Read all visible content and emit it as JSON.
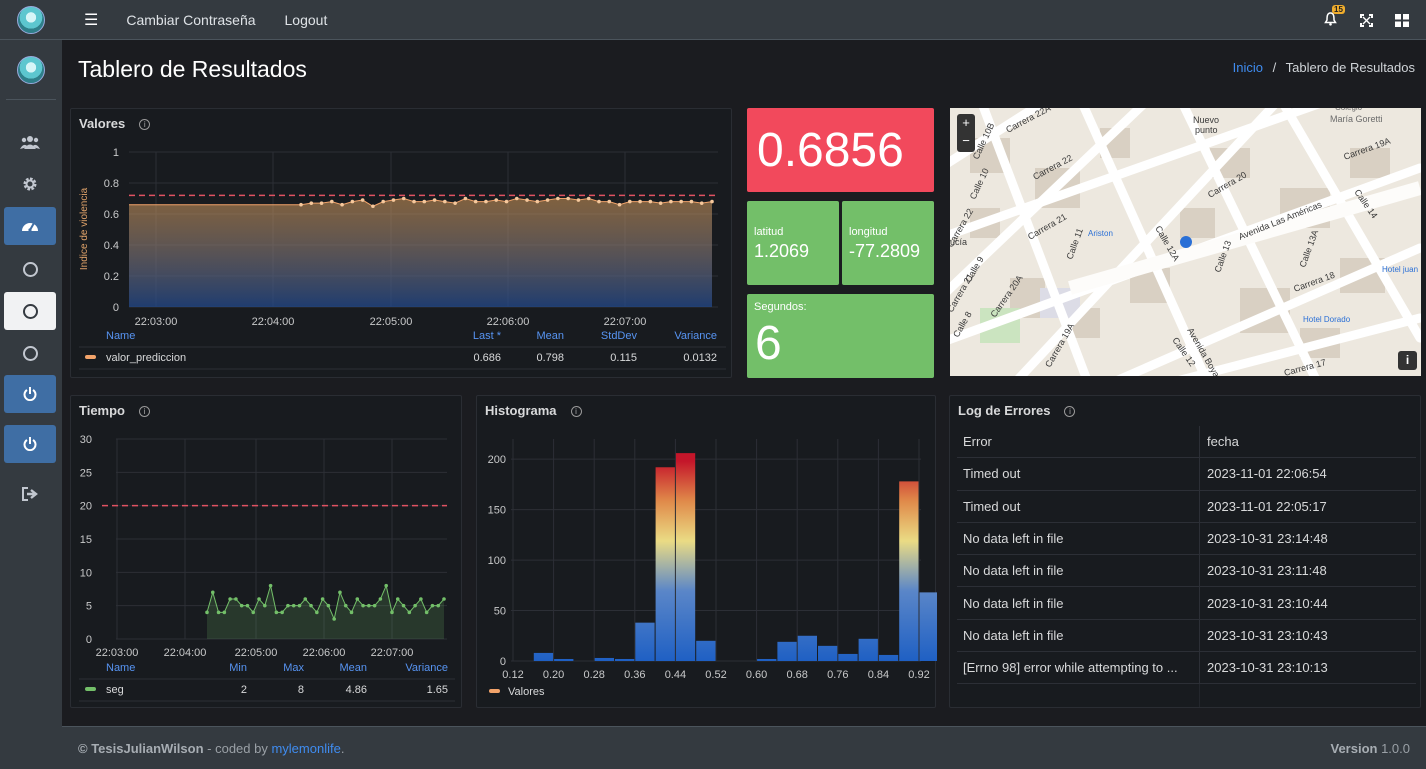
{
  "nav": {
    "change_password": "Cambiar Contraseña",
    "logout": "Logout",
    "notifications": "15"
  },
  "page": {
    "title": "Tablero de Resultados",
    "breadcrumb_home": "Inicio",
    "breadcrumb_sep": "/",
    "breadcrumb_current": "Tablero de Resultados"
  },
  "sidebar": {
    "items": [
      "users-icon",
      "gear-icon",
      "dashboard-icon",
      "circle-icon",
      "circle-icon",
      "circle-icon",
      "power-icon",
      "power-icon",
      "sign-out-icon"
    ]
  },
  "valores": {
    "title": "Valores",
    "legend_headers": {
      "name": "Name",
      "last": "Last *",
      "mean": "Mean",
      "stddev": "StdDev",
      "variance": "Variance"
    },
    "legend_row": {
      "name": "valor_prediccion",
      "last": "0.686",
      "mean": "0.798",
      "stddev": "0.115",
      "variance": "0.0132"
    }
  },
  "stat_value": {
    "value": "0.6856",
    "color": "#f2495c"
  },
  "lat": {
    "label": "latitud",
    "value": "1.2069"
  },
  "lon": {
    "label": "longitud",
    "value": "-77.2809"
  },
  "seconds": {
    "label": "Segundos:",
    "value": "6"
  },
  "map": {
    "zoom_in": "+",
    "zoom_out": "−",
    "info": "i",
    "labels": [
      "Carrera 22A",
      "Nuevo punto",
      "Colegio María Goretti",
      "Carrera 19A",
      "Calle 10B",
      "Carrera 22",
      "Carrera 20",
      "Calle 14",
      "Calle 10",
      "Carrera 22",
      "Calle 12A",
      "Avenida Las Américas",
      "Carrera 21",
      "Ariston",
      "Calle 11",
      "Calle 9",
      "Calle 13",
      "Calle 13A",
      "Hotel juan",
      "Carrera 21",
      "Carrera 20A",
      "Carrera 18",
      "Calle 8",
      "Hotel Dorado",
      "Calle 12",
      "Avenida Boya",
      "Carrera 19A",
      "Carrera 17",
      "ucía"
    ]
  },
  "tiempo": {
    "title": "Tiempo",
    "legend_headers": {
      "name": "Name",
      "min": "Min",
      "max": "Max",
      "mean": "Mean",
      "variance": "Variance"
    },
    "legend_row": {
      "name": "seg",
      "min": "2",
      "max": "8",
      "mean": "4.86",
      "variance": "1.65"
    }
  },
  "histograma": {
    "title": "Histograma",
    "legend": "Valores"
  },
  "errores": {
    "title": "Log de Errores",
    "headers": [
      "Error",
      "fecha"
    ],
    "rows": [
      [
        "Timed out",
        "2023-11-01 22:06:54"
      ],
      [
        "Timed out",
        "2023-11-01 22:05:17"
      ],
      [
        "No data left in file",
        "2023-10-31 23:14:48"
      ],
      [
        "No data left in file",
        "2023-10-31 23:11:48"
      ],
      [
        "No data left in file",
        "2023-10-31 23:10:44"
      ],
      [
        "No data left in file",
        "2023-10-31 23:10:43"
      ],
      [
        "[Errno 98] error while attempting to ...",
        "2023-10-31 23:10:13"
      ]
    ]
  },
  "footer": {
    "copyright": "© TesisJulianWilson",
    "coded_by": " - coded by ",
    "author": "mylemonlife",
    "period": ".",
    "version_label": "Version",
    "version": "1.0.0"
  },
  "chart_data": [
    {
      "type": "area",
      "ylabel": "Indice de violencia",
      "ylim": [
        0,
        1
      ],
      "yticks": [
        "0",
        "0.2",
        "0.4",
        "0.6",
        "0.8",
        "1"
      ],
      "xticks": [
        "22:03:00",
        "22:04:00",
        "22:05:00",
        "22:06:00",
        "22:07:00"
      ],
      "threshold": 0.72,
      "flat_before": 0.66,
      "series": [
        {
          "name": "valor_prediccion",
          "values": [
            0.66,
            0.67,
            0.67,
            0.68,
            0.66,
            0.68,
            0.69,
            0.65,
            0.68,
            0.69,
            0.7,
            0.68,
            0.68,
            0.69,
            0.68,
            0.67,
            0.7,
            0.68,
            0.68,
            0.69,
            0.68,
            0.7,
            0.69,
            0.68,
            0.69,
            0.7,
            0.7,
            0.69,
            0.7,
            0.68,
            0.68,
            0.66,
            0.68,
            0.68,
            0.68,
            0.67,
            0.68,
            0.68,
            0.68,
            0.67,
            0.68
          ]
        }
      ]
    },
    {
      "type": "line",
      "ylim": [
        0,
        30
      ],
      "yticks": [
        "0",
        "5",
        "10",
        "15",
        "20",
        "25",
        "30"
      ],
      "xticks": [
        "22:03:00",
        "22:04:00",
        "22:05:00",
        "22:06:00",
        "22:07:00"
      ],
      "threshold": 20,
      "series": [
        {
          "name": "seg",
          "values": [
            4,
            7,
            4,
            4,
            6,
            6,
            5,
            5,
            4,
            6,
            5,
            8,
            4,
            4,
            5,
            5,
            5,
            6,
            5,
            4,
            6,
            5,
            3,
            7,
            5,
            4,
            6,
            5,
            5,
            5,
            6,
            8,
            4,
            6,
            5,
            4,
            5,
            6,
            4,
            5,
            5,
            6
          ]
        }
      ]
    },
    {
      "type": "bar",
      "xticks": [
        "0.12",
        "0.20",
        "0.28",
        "0.36",
        "0.44",
        "0.52",
        "0.60",
        "0.68",
        "0.76",
        "0.84",
        "0.92"
      ],
      "yticks": [
        "0",
        "50",
        "100",
        "150",
        "200"
      ],
      "ylim": [
        0,
        220
      ],
      "series": [
        {
          "name": "Valores",
          "values": [
            0,
            8,
            2,
            0,
            3,
            2,
            38,
            192,
            206,
            20,
            0,
            0,
            2,
            19,
            25,
            15,
            7,
            22,
            6,
            178,
            68
          ]
        }
      ]
    }
  ]
}
